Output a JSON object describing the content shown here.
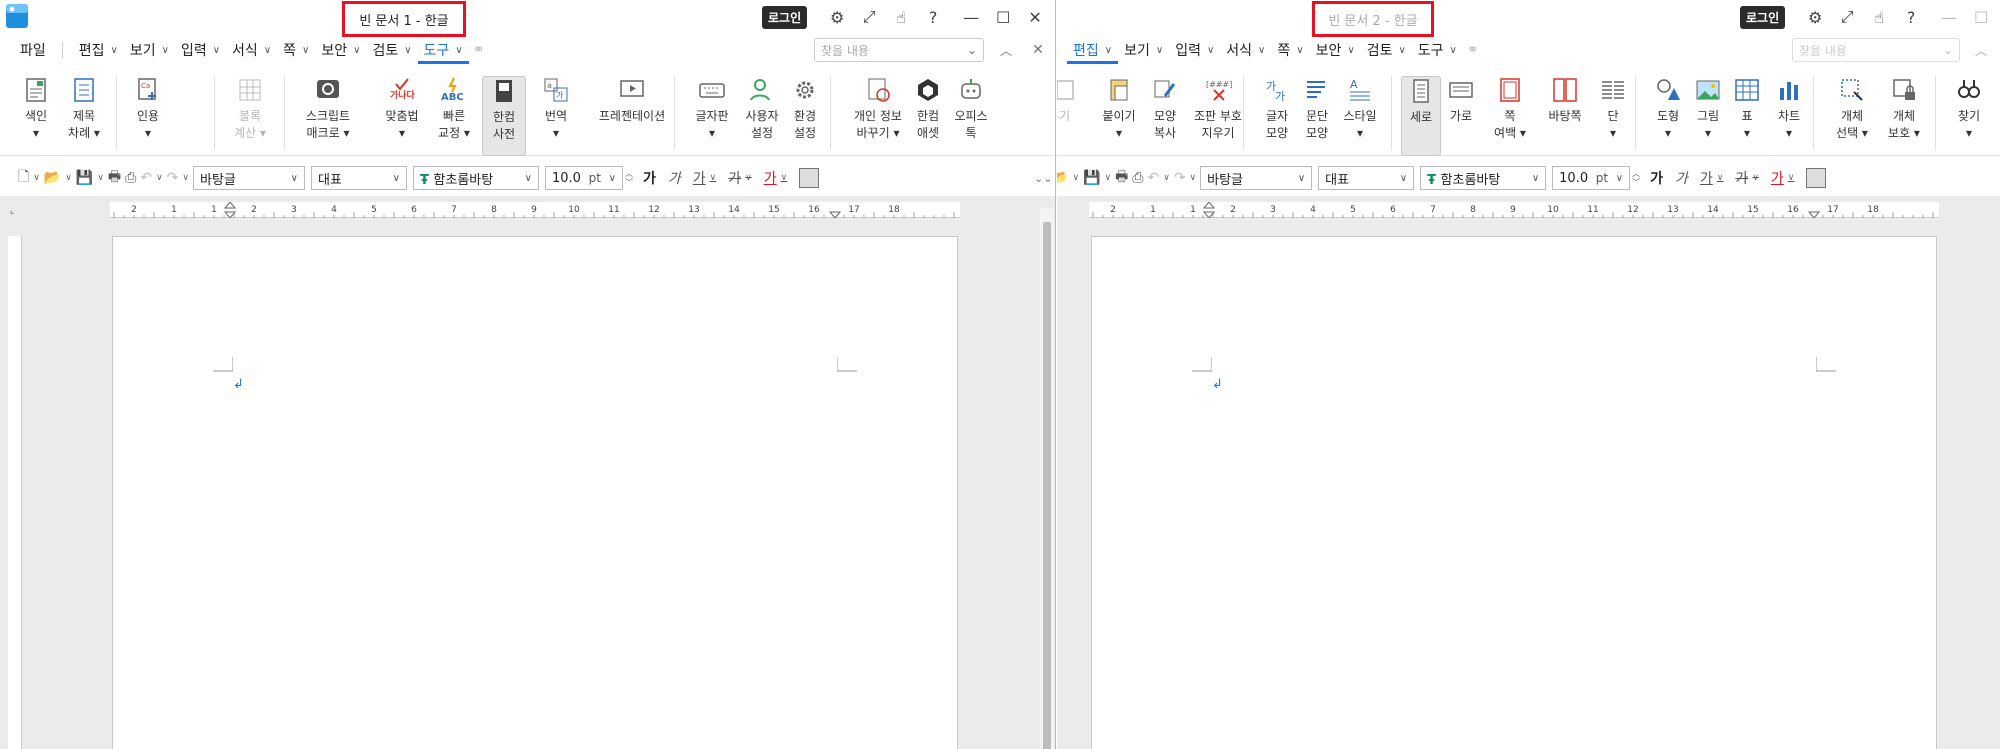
{
  "windows": [
    {
      "id": "doc1",
      "title": "빈 문서 1 - 한글",
      "active": true,
      "login_label": "로그인",
      "menu": [
        {
          "label": "파일",
          "has_chevron": false,
          "active": false
        },
        {
          "label": "편집",
          "has_chevron": true,
          "active": false
        },
        {
          "label": "보기",
          "has_chevron": true,
          "active": false
        },
        {
          "label": "입력",
          "has_chevron": true,
          "active": false
        },
        {
          "label": "서식",
          "has_chevron": true,
          "active": false
        },
        {
          "label": "쪽",
          "has_chevron": true,
          "active": false
        },
        {
          "label": "보안",
          "has_chevron": true,
          "active": false
        },
        {
          "label": "검토",
          "has_chevron": true,
          "active": false
        },
        {
          "label": "도구",
          "has_chevron": true,
          "active": true
        }
      ],
      "search_placeholder": "찾을 내용",
      "ribbon": [
        {
          "name": "index",
          "icon": "index-icon",
          "lines": [
            "색인",
            "▾"
          ]
        },
        {
          "name": "toc",
          "icon": "toc-icon",
          "lines": [
            "제목",
            "차례 ▾"
          ]
        },
        {
          "name": "citation",
          "icon": "citation-icon",
          "lines": [
            "인용",
            "▾"
          ]
        },
        {
          "name": "block-calc",
          "icon": "block-calc-icon",
          "lines": [
            "블록",
            "계산 ▾"
          ],
          "disabled": true
        },
        {
          "name": "script-macro",
          "icon": "script-macro-icon",
          "lines": [
            "스크립트",
            "매크로 ▾"
          ]
        },
        {
          "name": "spellcheck",
          "icon": "spellcheck-icon",
          "lines": [
            "맞춤법",
            "▾"
          ]
        },
        {
          "name": "quick-fix",
          "icon": "quick-fix-icon",
          "lines": [
            "빠른",
            "교정 ▾"
          ]
        },
        {
          "name": "hancom-dict",
          "icon": "hancom-dict-icon",
          "lines": [
            "한컴",
            "사전"
          ],
          "pressed": true
        },
        {
          "name": "translate",
          "icon": "translate-icon",
          "lines": [
            "번역",
            "▾"
          ]
        },
        {
          "name": "presentation",
          "icon": "presentation-icon",
          "lines": [
            "프레젠테이션",
            ""
          ]
        },
        {
          "name": "keyboard",
          "icon": "keyboard-icon",
          "lines": [
            "글자판",
            "▾"
          ]
        },
        {
          "name": "user-settings",
          "icon": "user-settings-icon",
          "lines": [
            "사용자",
            "설정"
          ]
        },
        {
          "name": "env-settings",
          "icon": "env-settings-icon",
          "lines": [
            "환경",
            "설정"
          ]
        },
        {
          "name": "personal-info",
          "icon": "personal-info-icon",
          "lines": [
            "개인 정보",
            "바꾸기 ▾"
          ]
        },
        {
          "name": "hancom-asset",
          "icon": "hancom-asset-icon",
          "lines": [
            "한컴",
            "애셋"
          ]
        },
        {
          "name": "office-talk",
          "icon": "office-talk-icon",
          "lines": [
            "오피스",
            "톡"
          ]
        }
      ],
      "format": {
        "style": "바탕글",
        "lang": "대표",
        "font": "함초롬바탕",
        "size": "10.0",
        "unit": "pt"
      },
      "ruler_ticks": [
        "2",
        "1",
        "1",
        "2",
        "3",
        "4",
        "5",
        "6",
        "7",
        "8",
        "9",
        "10",
        "11",
        "12",
        "13",
        "14",
        "15",
        "16",
        "17",
        "18"
      ]
    },
    {
      "id": "doc2",
      "title": "빈 문서 2 - 한글",
      "active": false,
      "login_label": "로그인",
      "menu": [
        {
          "label": "편집",
          "has_chevron": true,
          "active": true
        },
        {
          "label": "보기",
          "has_chevron": true,
          "active": false
        },
        {
          "label": "입력",
          "has_chevron": true,
          "active": false
        },
        {
          "label": "서식",
          "has_chevron": true,
          "active": false
        },
        {
          "label": "쪽",
          "has_chevron": true,
          "active": false
        },
        {
          "label": "보안",
          "has_chevron": true,
          "active": false
        },
        {
          "label": "검토",
          "has_chevron": true,
          "active": false
        },
        {
          "label": "도구",
          "has_chevron": true,
          "active": false
        }
      ],
      "search_placeholder": "찾을 내용",
      "ribbon": [
        {
          "name": "paste",
          "icon": "paste-icon",
          "lines": [
            "붙이기",
            "▾"
          ]
        },
        {
          "name": "format-copy",
          "icon": "format-copy-icon",
          "lines": [
            "모양",
            "복사"
          ]
        },
        {
          "name": "clear-codes",
          "icon": "clear-codes-icon",
          "lines": [
            "조판 부호",
            "지우기"
          ]
        },
        {
          "name": "char-shape",
          "icon": "char-shape-icon",
          "lines": [
            "글자",
            "모양"
          ]
        },
        {
          "name": "para-shape",
          "icon": "para-shape-icon",
          "lines": [
            "문단",
            "모양"
          ]
        },
        {
          "name": "style",
          "icon": "style-icon",
          "lines": [
            "스타일",
            "▾"
          ]
        },
        {
          "name": "portrait",
          "icon": "portrait-icon",
          "lines": [
            "세로",
            ""
          ],
          "pressed": true
        },
        {
          "name": "landscape",
          "icon": "landscape-icon",
          "lines": [
            "가로",
            ""
          ]
        },
        {
          "name": "page-margin",
          "icon": "page-margin-icon",
          "lines": [
            "쪽",
            "여백 ▾"
          ]
        },
        {
          "name": "background-page",
          "icon": "background-page-icon",
          "lines": [
            "바탕쪽",
            ""
          ]
        },
        {
          "name": "columns",
          "icon": "columns-icon",
          "lines": [
            "단",
            "▾"
          ]
        },
        {
          "name": "shape",
          "icon": "shape-icon",
          "lines": [
            "도형",
            "▾"
          ]
        },
        {
          "name": "picture",
          "icon": "picture-icon",
          "lines": [
            "그림",
            "▾"
          ]
        },
        {
          "name": "table",
          "icon": "table-icon",
          "lines": [
            "표",
            "▾"
          ]
        },
        {
          "name": "chart",
          "icon": "chart-icon",
          "lines": [
            "차트",
            "▾"
          ]
        },
        {
          "name": "object-select",
          "icon": "object-select-icon",
          "lines": [
            "개체",
            "선택 ▾"
          ]
        },
        {
          "name": "object-protect",
          "icon": "object-protect-icon",
          "lines": [
            "개체",
            "보호 ▾"
          ]
        },
        {
          "name": "find",
          "icon": "find-icon",
          "lines": [
            "찾기",
            "▾"
          ]
        }
      ],
      "cut_label": "오려두기",
      "format": {
        "style": "바탕글",
        "lang": "대표",
        "font": "함초롬바탕",
        "size": "10.0",
        "unit": "pt"
      },
      "ruler_ticks": [
        "2",
        "1",
        "1",
        "2",
        "3",
        "4",
        "5",
        "6",
        "7",
        "8",
        "9",
        "10",
        "11",
        "12",
        "13",
        "14",
        "15",
        "16",
        "17",
        "18"
      ]
    }
  ],
  "text_buttons": {
    "bold": "가",
    "italic": "가",
    "underline": "가",
    "strike": "가",
    "color": "가"
  },
  "colors": {
    "accent": "#1a73e8",
    "title_highlight": "#e81123",
    "text_color_red": "#e81123"
  }
}
